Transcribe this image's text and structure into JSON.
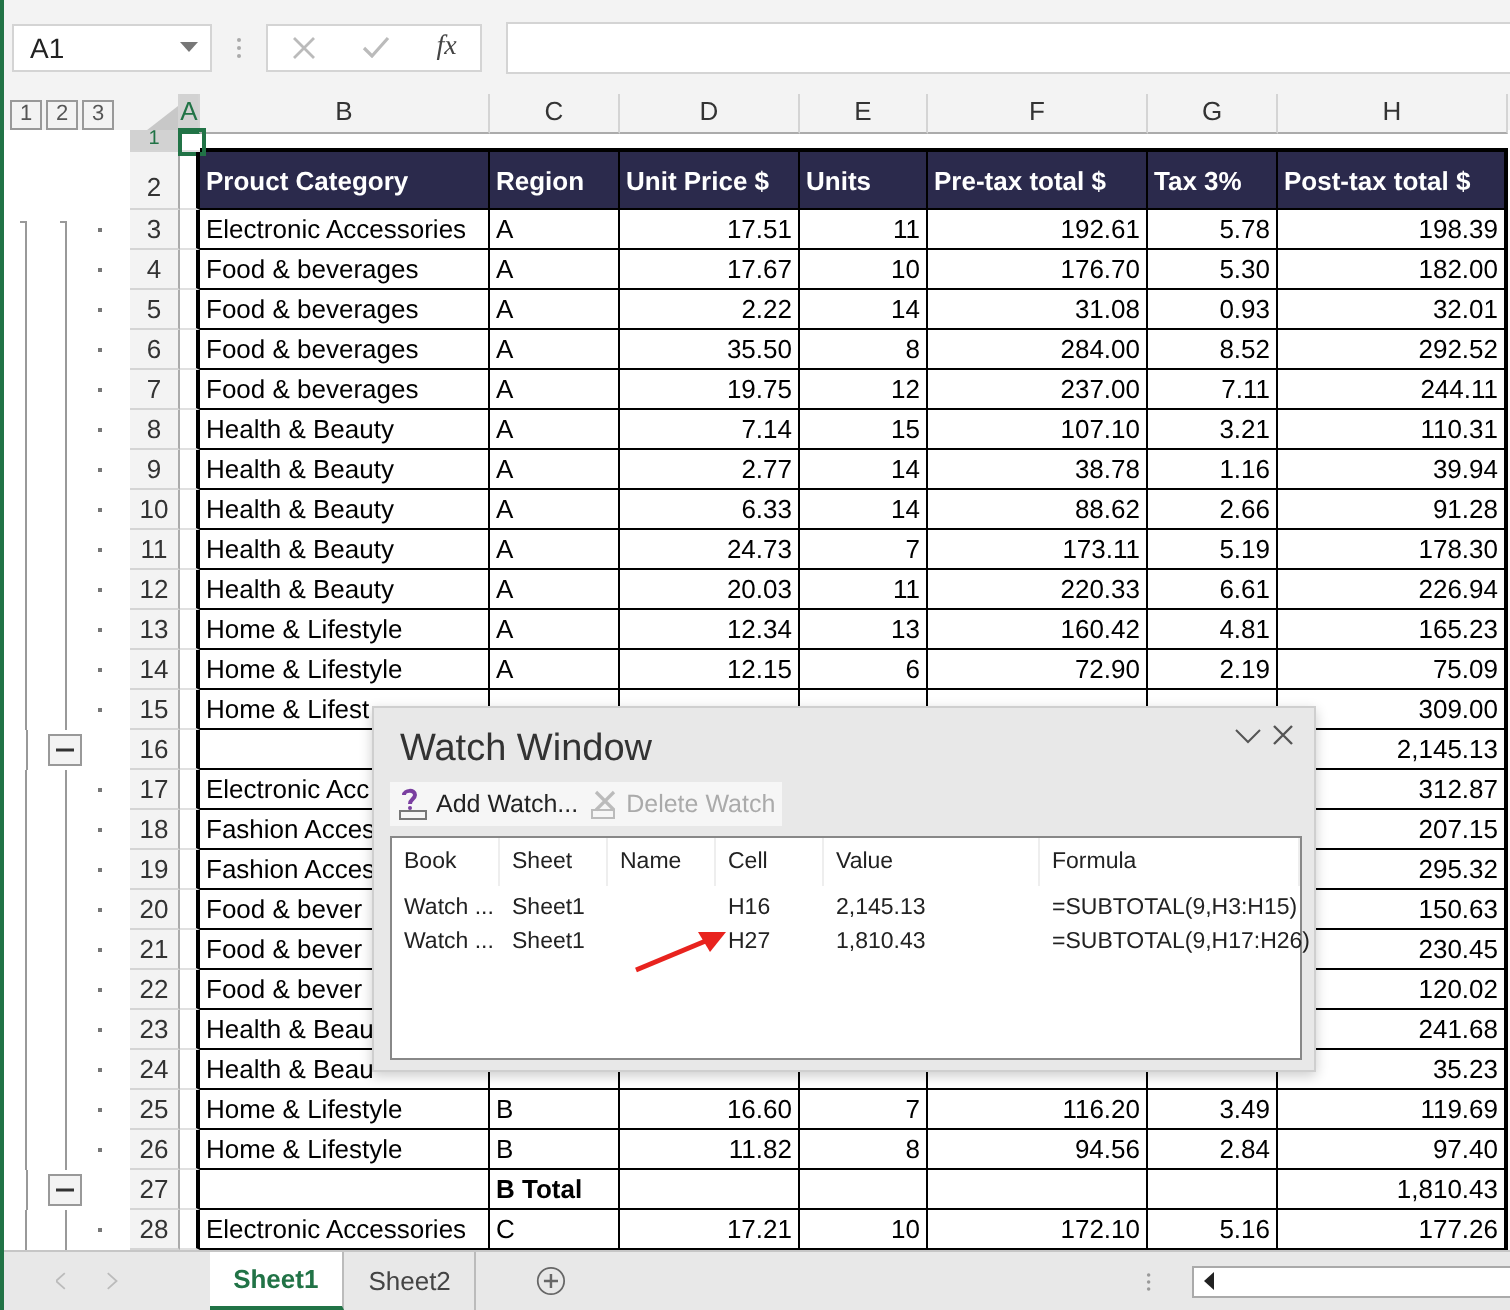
{
  "formula_bar": {
    "name_box": "A1",
    "function_label": "fx"
  },
  "outline_levels": [
    {
      "label": "1"
    },
    {
      "label": "2"
    },
    {
      "label": "3"
    }
  ],
  "columns": [
    {
      "label": "A",
      "selected": true
    },
    {
      "label": "B",
      "selected": false
    },
    {
      "label": "C",
      "selected": false
    },
    {
      "label": "D",
      "selected": false
    },
    {
      "label": "E",
      "selected": false
    },
    {
      "label": "F",
      "selected": false
    },
    {
      "label": "G",
      "selected": false
    },
    {
      "label": "H",
      "selected": false
    }
  ],
  "rows": [
    {
      "number": "1",
      "selected": true,
      "kind": "blank",
      "cells": [
        null,
        null,
        null,
        null,
        null,
        null,
        null
      ]
    },
    {
      "number": "2",
      "selected": false,
      "kind": "header",
      "cells": [
        "Prouct Category",
        "Region",
        "Unit Price $",
        "Units",
        "Pre-tax total $",
        "Tax 3%",
        "Post-tax total $"
      ]
    },
    {
      "number": "3",
      "selected": false,
      "kind": "data",
      "cells": [
        "Electronic Accessories",
        "A",
        "17.51",
        "11",
        "192.61",
        "5.78",
        "198.39"
      ]
    },
    {
      "number": "4",
      "selected": false,
      "kind": "data",
      "cells": [
        "Food & beverages",
        "A",
        "17.67",
        "10",
        "176.70",
        "5.30",
        "182.00"
      ]
    },
    {
      "number": "5",
      "selected": false,
      "kind": "data",
      "cells": [
        "Food & beverages",
        "A",
        "2.22",
        "14",
        "31.08",
        "0.93",
        "32.01"
      ]
    },
    {
      "number": "6",
      "selected": false,
      "kind": "data",
      "cells": [
        "Food & beverages",
        "A",
        "35.50",
        "8",
        "284.00",
        "8.52",
        "292.52"
      ]
    },
    {
      "number": "7",
      "selected": false,
      "kind": "data",
      "cells": [
        "Food & beverages",
        "A",
        "19.75",
        "12",
        "237.00",
        "7.11",
        "244.11"
      ]
    },
    {
      "number": "8",
      "selected": false,
      "kind": "data",
      "cells": [
        "Health & Beauty",
        "A",
        "7.14",
        "15",
        "107.10",
        "3.21",
        "110.31"
      ]
    },
    {
      "number": "9",
      "selected": false,
      "kind": "data",
      "cells": [
        "Health & Beauty",
        "A",
        "2.77",
        "14",
        "38.78",
        "1.16",
        "39.94"
      ]
    },
    {
      "number": "10",
      "selected": false,
      "kind": "data",
      "cells": [
        "Health & Beauty",
        "A",
        "6.33",
        "14",
        "88.62",
        "2.66",
        "91.28"
      ]
    },
    {
      "number": "11",
      "selected": false,
      "kind": "data",
      "cells": [
        "Health & Beauty",
        "A",
        "24.73",
        "7",
        "173.11",
        "5.19",
        "178.30"
      ]
    },
    {
      "number": "12",
      "selected": false,
      "kind": "data",
      "cells": [
        "Health & Beauty",
        "A",
        "20.03",
        "11",
        "220.33",
        "6.61",
        "226.94"
      ]
    },
    {
      "number": "13",
      "selected": false,
      "kind": "data",
      "cells": [
        "Home & Lifestyle",
        "A",
        "12.34",
        "13",
        "160.42",
        "4.81",
        "165.23"
      ]
    },
    {
      "number": "14",
      "selected": false,
      "kind": "data",
      "cells": [
        "Home & Lifestyle",
        "A",
        "12.15",
        "6",
        "72.90",
        "2.19",
        "75.09"
      ]
    },
    {
      "number": "15",
      "selected": false,
      "kind": "data",
      "cells": [
        "Home & Lifest",
        null,
        null,
        null,
        null,
        null,
        "309.00"
      ]
    },
    {
      "number": "16",
      "selected": false,
      "kind": "total",
      "cells": [
        null,
        null,
        null,
        null,
        null,
        null,
        "2,145.13"
      ]
    },
    {
      "number": "17",
      "selected": false,
      "kind": "data",
      "cells": [
        "Electronic Acc",
        null,
        null,
        null,
        null,
        null,
        "312.87"
      ]
    },
    {
      "number": "18",
      "selected": false,
      "kind": "data",
      "cells": [
        "Fashion Acces",
        null,
        null,
        null,
        null,
        null,
        "207.15"
      ]
    },
    {
      "number": "19",
      "selected": false,
      "kind": "data",
      "cells": [
        "Fashion Acces",
        null,
        null,
        null,
        null,
        null,
        "295.32"
      ]
    },
    {
      "number": "20",
      "selected": false,
      "kind": "data",
      "cells": [
        "Food & bever",
        null,
        null,
        null,
        null,
        null,
        "150.63"
      ]
    },
    {
      "number": "21",
      "selected": false,
      "kind": "data",
      "cells": [
        "Food & bever",
        null,
        null,
        null,
        null,
        null,
        "230.45"
      ]
    },
    {
      "number": "22",
      "selected": false,
      "kind": "data",
      "cells": [
        "Food & bever",
        null,
        null,
        null,
        null,
        null,
        "120.02"
      ]
    },
    {
      "number": "23",
      "selected": false,
      "kind": "data",
      "cells": [
        "Health & Beau",
        null,
        null,
        null,
        null,
        null,
        "241.68"
      ]
    },
    {
      "number": "24",
      "selected": false,
      "kind": "data",
      "cells": [
        "Health & Beau",
        null,
        null,
        null,
        null,
        null,
        "35.23"
      ]
    },
    {
      "number": "25",
      "selected": false,
      "kind": "data",
      "cells": [
        "Home & Lifestyle",
        "B",
        "16.60",
        "7",
        "116.20",
        "3.49",
        "119.69"
      ]
    },
    {
      "number": "26",
      "selected": false,
      "kind": "data",
      "cells": [
        "Home & Lifestyle",
        "B",
        "11.82",
        "8",
        "94.56",
        "2.84",
        "97.40"
      ]
    },
    {
      "number": "27",
      "selected": false,
      "kind": "total",
      "cells": [
        null,
        "B Total",
        null,
        null,
        null,
        null,
        "1,810.43"
      ]
    },
    {
      "number": "28",
      "selected": false,
      "kind": "data",
      "cells": [
        "Electronic Accessories",
        "C",
        "17.21",
        "10",
        "172.10",
        "5.16",
        "177.26"
      ]
    }
  ],
  "watch_window": {
    "title": "Watch Window",
    "add_button": {
      "label": "Add Watch...",
      "disabled": false
    },
    "delete_button": {
      "label": "Delete Watch",
      "disabled": true
    },
    "columns": [
      "Book",
      "Sheet",
      "Name",
      "Cell",
      "Value",
      "Formula"
    ],
    "rows": [
      [
        "Watch ...",
        "Sheet1",
        null,
        "H16",
        "2,145.13",
        "=SUBTOTAL(9,H3:H15)"
      ],
      [
        "Watch ...",
        "Sheet1",
        null,
        "H27",
        "1,810.43",
        "=SUBTOTAL(9,H17:H26)"
      ]
    ]
  },
  "sheet_tabs": [
    {
      "label": "Sheet1",
      "selected": true
    },
    {
      "label": "Sheet2",
      "selected": false
    }
  ]
}
